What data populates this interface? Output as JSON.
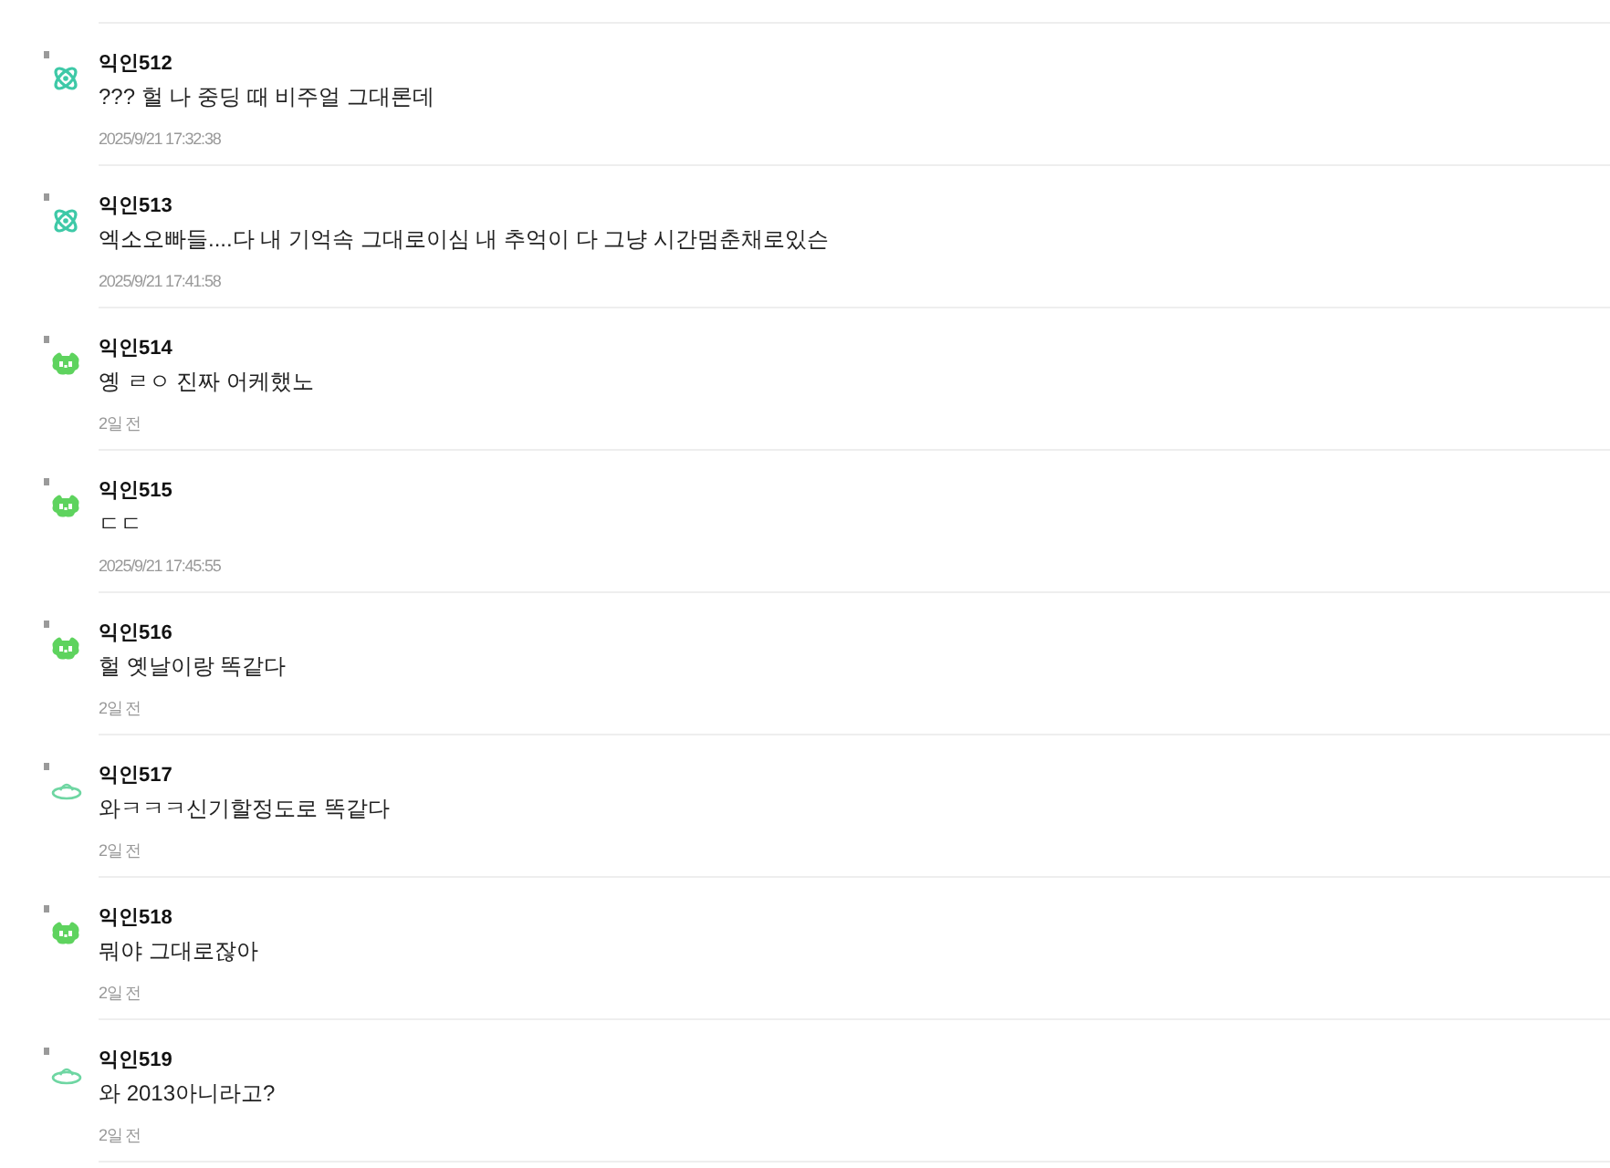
{
  "comments": [
    {
      "kind": "atom",
      "name": "익인512",
      "text": "??? 헐 나 중딩 때 비주얼 그대론데",
      "time": "2025/9/21 17:32:38"
    },
    {
      "kind": "atom",
      "name": "익인513",
      "text": "엑소오빠들....다 내 기억속 그대로이심 내 추억이 다 그냥 시간멈춘채로있슨",
      "time": "2025/9/21 17:41:58"
    },
    {
      "kind": "critter",
      "name": "익인514",
      "text": "옝 ㄹㅇ 진짜 어케했노",
      "time": "2일 전"
    },
    {
      "kind": "critter",
      "name": "익인515",
      "text": "ㄷㄷ",
      "time": "2025/9/21 17:45:55"
    },
    {
      "kind": "critter",
      "name": "익인516",
      "text": "헐 옛날이랑 똑같다",
      "time": "2일 전"
    },
    {
      "kind": "ufo",
      "name": "익인517",
      "text": "와ㅋㅋㅋ신기할정도로 똑같다",
      "time": "2일 전"
    },
    {
      "kind": "critter",
      "name": "익인518",
      "text": "뭐야 그대로잖아",
      "time": "2일 전"
    },
    {
      "kind": "ufo",
      "name": "익인519",
      "text": "와 2013아니라고?",
      "time": "2일 전"
    }
  ]
}
